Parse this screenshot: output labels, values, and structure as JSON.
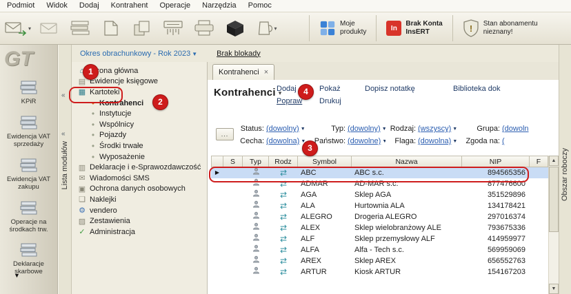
{
  "menubar": {
    "items": [
      "Podmiot",
      "Widok",
      "Dodaj",
      "Kontrahent",
      "Operacje",
      "Narzędzia",
      "Pomoc"
    ]
  },
  "toolbar": {
    "moje_produkty": {
      "line1": "Moje",
      "line2": "produkty"
    },
    "brak_konta": {
      "line1": "Brak Konta",
      "line2": "InsERT"
    },
    "abonament": {
      "line1": "Stan abonamentu",
      "line2": "nieznany!"
    }
  },
  "module_bar": {
    "logo": "GT",
    "strip_label": "Lista modułów",
    "items": [
      {
        "label": "KPiR",
        "icon": "kpir-icon"
      },
      {
        "label": "Ewidencja VAT sprzedaży",
        "icon": "vat-sales-icon"
      },
      {
        "label": "Ewidencja VAT zakupu",
        "icon": "vat-purchase-icon"
      },
      {
        "label": "Operacje na środkach trw.",
        "icon": "fixed-assets-icon"
      },
      {
        "label": "Deklaracje skarbowe",
        "icon": "tax-declarations-icon"
      }
    ]
  },
  "period_bar": {
    "period": "Okres obrachunkowy - Rok 2023",
    "lock": "Brak blokady"
  },
  "tree": {
    "items": [
      {
        "label": "Strona główna",
        "icon": "home-icon",
        "level": 0
      },
      {
        "label": "Ewidencje księgowe",
        "icon": "ledger-icon",
        "level": 0
      },
      {
        "label": "Kartoteki",
        "icon": "cardfile-icon",
        "level": 0
      },
      {
        "label": "Kontrahenci",
        "icon": "bullet",
        "level": 1,
        "active": true
      },
      {
        "label": "Instytucje",
        "icon": "bullet",
        "level": 1
      },
      {
        "label": "Wspólnicy",
        "icon": "bullet",
        "level": 1
      },
      {
        "label": "Pojazdy",
        "icon": "bullet",
        "level": 1
      },
      {
        "label": "Środki trwałe",
        "icon": "bullet",
        "level": 1
      },
      {
        "label": "Wyposażenie",
        "icon": "bullet",
        "level": 1
      },
      {
        "label": "Deklaracje i e-Sprawozdawczość",
        "icon": "declarations-icon",
        "level": 0
      },
      {
        "label": "Wiadomości SMS",
        "icon": "sms-icon",
        "level": 0
      },
      {
        "label": "Ochrona danych osobowych",
        "icon": "privacy-icon",
        "level": 0
      },
      {
        "label": "Naklejki",
        "icon": "stickers-icon",
        "level": 0
      },
      {
        "label": "vendero",
        "icon": "vendero-icon",
        "level": 0
      },
      {
        "label": "Zestawienia",
        "icon": "reports-icon",
        "level": 0
      },
      {
        "label": "Administracja",
        "icon": "admin-icon",
        "level": 0
      }
    ]
  },
  "icons": {
    "home-icon": {
      "glyph": "⌂",
      "color": "#2e7d8c"
    },
    "ledger-icon": {
      "glyph": "▤",
      "color": "#8a8878"
    },
    "cardfile-icon": {
      "glyph": "▦",
      "color": "#2e7d8c"
    },
    "bullet": {
      "glyph": "•",
      "color": "#9aa08a"
    },
    "bullet-active": {
      "glyph": "•",
      "color": "#d4691e"
    },
    "declarations-icon": {
      "glyph": "▥",
      "color": "#8a8878"
    },
    "sms-icon": {
      "glyph": "✉",
      "color": "#8a8878"
    },
    "privacy-icon": {
      "glyph": "▣",
      "color": "#8a8878"
    },
    "stickers-icon": {
      "glyph": "❏",
      "color": "#8a8878"
    },
    "vendero-icon": {
      "glyph": "⚙",
      "color": "#3a6fb5"
    },
    "reports-icon": {
      "glyph": "▨",
      "color": "#8a8878"
    },
    "admin-icon": {
      "glyph": "✓",
      "color": "#3f9a3f"
    },
    "transfer-icon": {
      "glyph": "⇄",
      "color": "#2f8f9f"
    }
  },
  "main": {
    "tab": "Kontrahenci",
    "title": "Kontrahenci",
    "workspace_label": "Obszar roboczy",
    "more_button": "...",
    "actions": [
      "Dodaj",
      "Popraw",
      "Pokaż",
      "Drukuj",
      "Dopisz notatkę",
      "Biblioteka dok"
    ],
    "filters": [
      {
        "label": "Status:",
        "value": "(dowolny)"
      },
      {
        "label": "Typ:",
        "value": "(dowolny)"
      },
      {
        "label": "Rodzaj:",
        "value": "(wszyscy)"
      },
      {
        "label": "Grupa:",
        "value": "(dowoln"
      },
      {
        "label": "Cecha:",
        "value": "(dowolna)"
      },
      {
        "label": "Państwo:",
        "value": "(dowolne)"
      },
      {
        "label": "Flaga:",
        "value": "(dowolna)"
      },
      {
        "label": "Zgoda na:",
        "value": "("
      }
    ],
    "table": {
      "columns": [
        "",
        "S",
        "Typ",
        "Rodz",
        "Symbol",
        "Nazwa",
        "NIP",
        "F"
      ],
      "rows": [
        {
          "symbol": "ABC",
          "nazwa": "ABC s.c.",
          "nip": "894565356",
          "selected": true
        },
        {
          "symbol": "ADMAR",
          "nazwa": "AD-MAR s.c.",
          "nip": "877476600"
        },
        {
          "symbol": "AGA",
          "nazwa": "Sklep AGA",
          "nip": "351529896"
        },
        {
          "symbol": "ALA",
          "nazwa": "Hurtownia ALA",
          "nip": "134178421"
        },
        {
          "symbol": "ALEGRO",
          "nazwa": "Drogeria ALEGRO",
          "nip": "297016374"
        },
        {
          "symbol": "ALEX",
          "nazwa": "Sklep wielobranżowy  ALE",
          "nip": "793675336"
        },
        {
          "symbol": "ALF",
          "nazwa": "Sklep przemysłowy ALF",
          "nip": "414959977"
        },
        {
          "symbol": "ALFA",
          "nazwa": "Alfa - Tech s.c.",
          "nip": "569959069"
        },
        {
          "symbol": "AREX",
          "nazwa": "Sklep AREX",
          "nip": "656552763"
        },
        {
          "symbol": "ARTUR",
          "nazwa": "Kiosk ARTUR",
          "nip": "154167203"
        }
      ]
    }
  },
  "annotations": {
    "step1": "1",
    "step2": "2",
    "step3": "3",
    "step4": "4"
  },
  "colors": {
    "annotation": "#ce1c1c",
    "selection": "#c9dcf5",
    "link": "#2a5db0",
    "period_link": "#2a6bb0"
  }
}
